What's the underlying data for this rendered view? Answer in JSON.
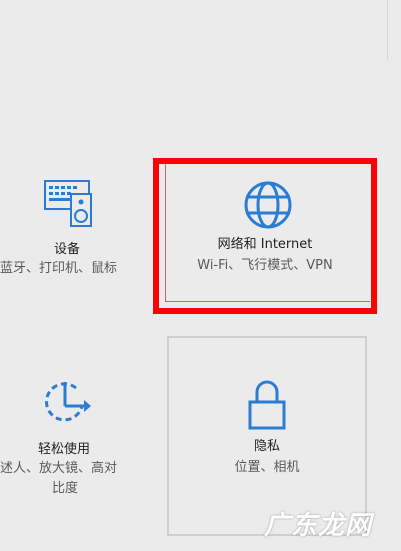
{
  "colors": {
    "accent": "#2b7cd3",
    "highlight_border": "#ff0000",
    "tile_border": "#cfcfcf",
    "background": "#ebebeb"
  },
  "tiles": [
    {
      "id": "devices",
      "title": "设备",
      "description": "蓝牙、打印机、鼠标",
      "icon": "keyboard-speaker-icon"
    },
    {
      "id": "network",
      "title": "网络和 Internet",
      "description": "Wi-Fi、飞行模式、VPN",
      "icon": "globe-icon",
      "highlighted": true
    },
    {
      "id": "ease",
      "title": "轻松使用",
      "description_line1": "讲述人、放大镜、高对",
      "description_line2": "比度",
      "icon": "ease-of-access-icon"
    },
    {
      "id": "privacy",
      "title": "隐私",
      "description": "位置、相机",
      "icon": "lock-icon"
    }
  ],
  "watermark": "广东龙网"
}
